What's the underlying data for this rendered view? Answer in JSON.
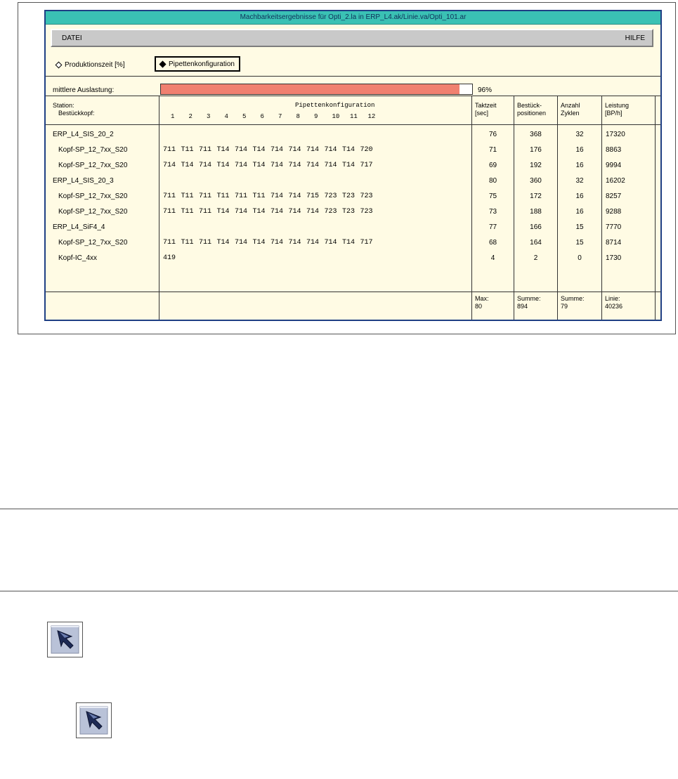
{
  "window": {
    "title": "Machbarkeitsergebnisse für Opti_2.la in ERP_L4.ak/Linie.va/Opti_101.ar"
  },
  "menu": {
    "datei": "DATEI",
    "hilfe": "HILFE"
  },
  "options": {
    "produktionszeit": "Produktionszeit [%]",
    "pipettenkonfiguration": "Pipettenkonfiguration",
    "selected": "pipettenkonfiguration"
  },
  "utilization": {
    "label": "mittlere Auslastung:",
    "value_text": "96%",
    "fraction": 0.96
  },
  "headers": {
    "station_line1": "Station:",
    "station_line2": "Bestückkopf:",
    "pipetten_title": "Pipettenkonfiguration",
    "pipetten_numbers": [
      "1",
      "2",
      "3",
      "4",
      "5",
      "6",
      "7",
      "8",
      "9",
      "10",
      "11",
      "12"
    ],
    "taktzeit_line1": "Taktzeit",
    "taktzeit_line2": "[sec]",
    "bestueck_line1": "Bestück-",
    "bestueck_line2": "positionen",
    "anzahl_line1": "Anzahl",
    "anzahl_line2": "Zyklen",
    "leistung_line1": "Leistung",
    "leistung_line2": "[BP/h]"
  },
  "rows": [
    {
      "name": "ERP_L4_SIS_20_2",
      "indent": false,
      "pipetten": [],
      "taktzeit": "76",
      "positionen": "368",
      "zyklen": "32",
      "leistung": "17320"
    },
    {
      "name": "Kopf-SP_12_7xx_S20",
      "indent": true,
      "pipetten": [
        "711",
        "T11",
        "711",
        "T14",
        "714",
        "T14",
        "714",
        "714",
        "714",
        "714",
        "T14",
        "720"
      ],
      "taktzeit": "71",
      "positionen": "176",
      "zyklen": "16",
      "leistung": "8863"
    },
    {
      "name": "Kopf-SP_12_7xx_S20",
      "indent": true,
      "pipetten": [
        "714",
        "T14",
        "714",
        "T14",
        "714",
        "T14",
        "714",
        "714",
        "714",
        "714",
        "T14",
        "717"
      ],
      "taktzeit": "69",
      "positionen": "192",
      "zyklen": "16",
      "leistung": "9994"
    },
    {
      "name": "ERP_L4_SIS_20_3",
      "indent": false,
      "pipetten": [],
      "taktzeit": "80",
      "positionen": "360",
      "zyklen": "32",
      "leistung": "16202"
    },
    {
      "name": "Kopf-SP_12_7xx_S20",
      "indent": true,
      "pipetten": [
        "711",
        "T11",
        "711",
        "T11",
        "711",
        "T11",
        "714",
        "714",
        "715",
        "723",
        "T23",
        "723"
      ],
      "taktzeit": "75",
      "positionen": "172",
      "zyklen": "16",
      "leistung": "8257"
    },
    {
      "name": "Kopf-SP_12_7xx_S20",
      "indent": true,
      "pipetten": [
        "711",
        "T11",
        "711",
        "T14",
        "714",
        "T14",
        "714",
        "714",
        "714",
        "723",
        "T23",
        "723"
      ],
      "taktzeit": "73",
      "positionen": "188",
      "zyklen": "16",
      "leistung": "9288"
    },
    {
      "name": "ERP_L4_SiF4_4",
      "indent": false,
      "pipetten": [],
      "taktzeit": "77",
      "positionen": "166",
      "zyklen": "15",
      "leistung": "7770"
    },
    {
      "name": "Kopf-SP_12_7xx_S20",
      "indent": true,
      "pipetten": [
        "711",
        "T11",
        "711",
        "T14",
        "714",
        "T14",
        "714",
        "714",
        "714",
        "714",
        "T14",
        "717"
      ],
      "taktzeit": "68",
      "positionen": "164",
      "zyklen": "15",
      "leistung": "8714"
    },
    {
      "name": "Kopf-IC_4xx",
      "indent": true,
      "pipetten": [
        "419"
      ],
      "taktzeit": "4",
      "positionen": "2",
      "zyklen": "0",
      "leistung": "1730"
    }
  ],
  "footer": {
    "taktzeit_line1": "Max:",
    "taktzeit_line2": "80",
    "positionen_line1": "Summe:",
    "positionen_line2": "894",
    "zyklen_line1": "Summe:",
    "zyklen_line2": "79",
    "leistung_line1": "Linie:",
    "leistung_line2": "40236"
  },
  "icons": [
    "select-arrow-icon",
    "select-arrow-icon"
  ]
}
